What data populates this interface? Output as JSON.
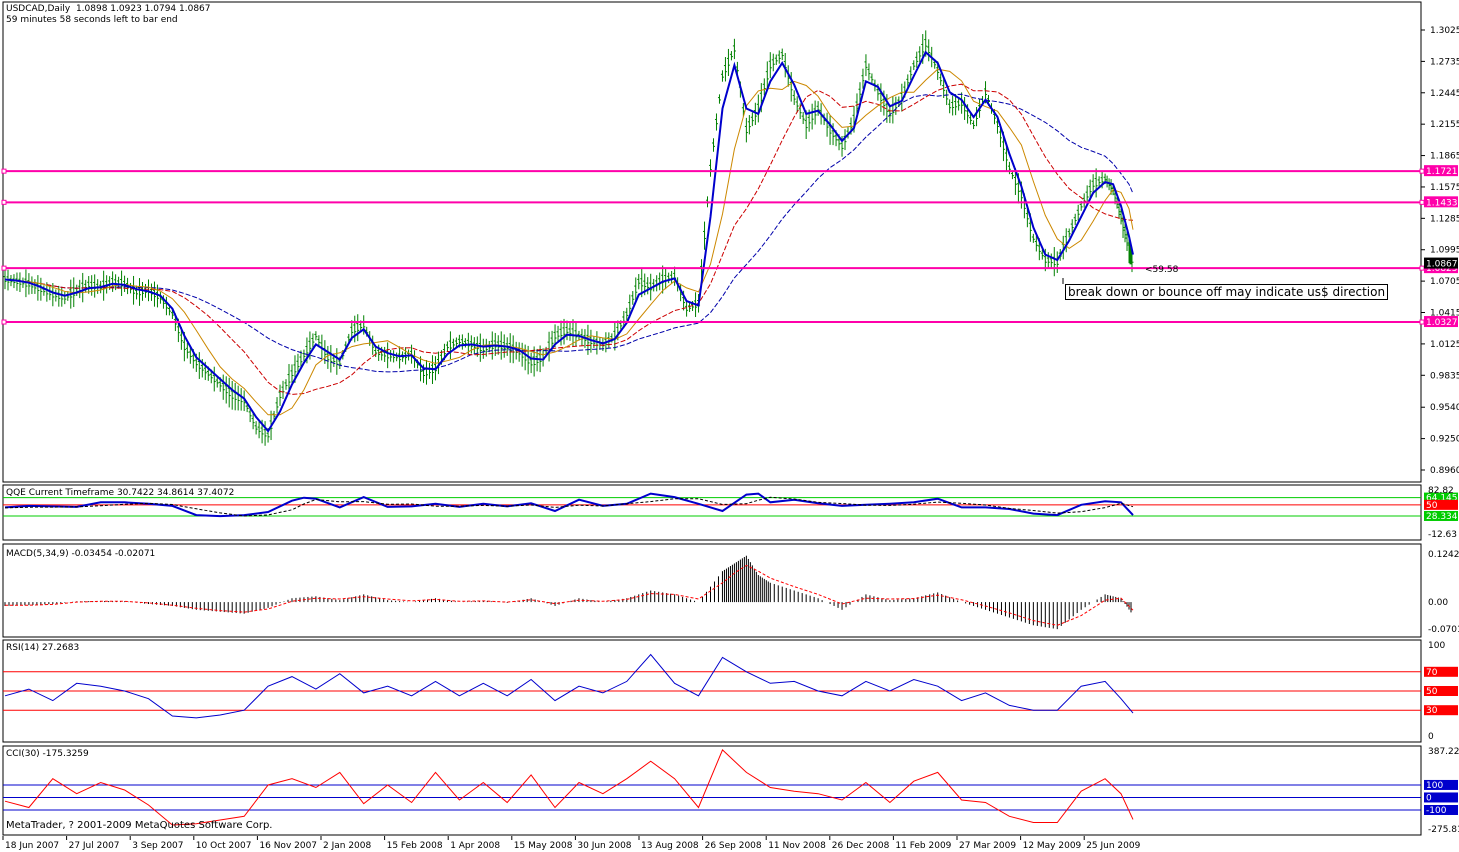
{
  "header": {
    "title": "USDCAD,Daily  1.0898 1.0923 1.0794 1.0867",
    "timer": "59 minutes 58 seconds left to bar end"
  },
  "annotations": {
    "main_note": "break down or bounce off may indicate us$ direction",
    "pips_label": "<59.58"
  },
  "footer": {
    "copyright": "MetaTrader, ? 2001-2009 MetaQuotes Software Corp."
  },
  "colors": {
    "price_bars": "#008000",
    "fast_ma": "#0000cc",
    "level_lines": "#ff00aa",
    "qqe_line": "#0000cc",
    "macd_hist": "#000000",
    "macd_signal": "#ff0000",
    "rsi_line": "#0000cc",
    "cci_line": "#ff0000",
    "green_level": "#00cc00",
    "red_level": "#ff0000"
  },
  "chart_data": [
    {
      "type": "line",
      "name": "price",
      "title": "USDCAD,Daily  1.0898 1.0923 1.0794 1.0867",
      "x_ticks": [
        "18 Jun 2007",
        "27 Jul 2007",
        "3 Sep 2007",
        "10 Oct 2007",
        "16 Nov 2007",
        "2 Jan 2008",
        "15 Feb 2008",
        "1 Apr 2008",
        "15 May 2008",
        "30 Jun 2008",
        "13 Aug 2008",
        "26 Sep 2008",
        "11 Nov 2008",
        "26 Dec 2008",
        "11 Feb 2009",
        "27 Mar 2009",
        "12 May 2009",
        "25 Jun 2009"
      ],
      "y_ticks": [
        "1.3025",
        "1.2735",
        "1.2445",
        "1.2155",
        "1.1865",
        "1.1575",
        "1.1285",
        "1.0995",
        "1.0705",
        "1.0415",
        "1.0125",
        "0.9835",
        "0.9540",
        "0.9250",
        "0.8960"
      ],
      "ylim": [
        0.896,
        1.31
      ],
      "current_price_label": "1.0867",
      "levels": [
        {
          "value": 1.1721,
          "label": "1.1721"
        },
        {
          "value": 1.1433,
          "label": "1.1433"
        },
        {
          "value": 1.0825,
          "label": "1.0825"
        },
        {
          "value": 1.0327,
          "label": "1.0327"
        }
      ],
      "x": [
        0,
        12,
        24,
        36,
        48,
        60,
        72,
        84,
        96,
        108,
        120,
        132,
        144,
        156,
        168,
        180,
        192,
        204,
        216,
        228,
        240,
        252,
        264,
        276,
        288,
        300,
        312,
        324,
        336,
        348,
        360,
        372,
        384,
        396,
        408,
        420,
        432,
        444,
        456,
        468,
        480,
        492,
        504,
        516,
        528,
        540,
        552,
        564,
        576,
        588,
        600,
        612,
        624,
        636,
        648,
        660,
        672,
        684,
        696,
        708,
        720,
        732,
        744,
        756,
        768,
        780,
        792,
        804,
        816,
        828,
        840,
        852,
        864,
        876,
        888,
        900,
        912,
        924,
        936,
        948,
        960,
        972,
        984,
        996,
        1008,
        1020,
        1032,
        1044,
        1056,
        1068,
        1080,
        1092,
        1104,
        1112,
        1120,
        1128,
        1132
      ],
      "close": [
        1.072,
        1.07,
        1.068,
        1.063,
        1.058,
        1.055,
        1.062,
        1.067,
        1.065,
        1.07,
        1.068,
        1.06,
        1.062,
        1.055,
        1.04,
        1.01,
        0.995,
        0.985,
        0.975,
        0.965,
        0.96,
        0.935,
        0.928,
        0.965,
        0.985,
        1.002,
        1.02,
        1.0,
        0.995,
        1.025,
        1.03,
        1.005,
        1.002,
        1.0,
        1.003,
        0.985,
        0.99,
        1.01,
        1.015,
        1.012,
        1.008,
        1.012,
        1.01,
        1.005,
        0.995,
        1.0,
        1.02,
        1.025,
        1.02,
        1.015,
        1.012,
        1.02,
        1.04,
        1.07,
        1.065,
        1.072,
        1.075,
        1.045,
        1.05,
        1.175,
        1.26,
        1.285,
        1.21,
        1.23,
        1.27,
        1.28,
        1.24,
        1.215,
        1.23,
        1.21,
        1.195,
        1.22,
        1.27,
        1.245,
        1.225,
        1.24,
        1.27,
        1.29,
        1.265,
        1.232,
        1.235,
        1.215,
        1.245,
        1.215,
        1.175,
        1.15,
        1.11,
        1.09,
        1.088,
        1.115,
        1.14,
        1.16,
        1.165,
        1.155,
        1.13,
        1.1,
        1.087
      ],
      "fast_ma": [
        1.072,
        1.071,
        1.069,
        1.065,
        1.06,
        1.057,
        1.06,
        1.064,
        1.065,
        1.068,
        1.067,
        1.063,
        1.061,
        1.057,
        1.045,
        1.02,
        1.0,
        0.99,
        0.98,
        0.97,
        0.962,
        0.945,
        0.932,
        0.95,
        0.975,
        0.995,
        1.012,
        1.005,
        0.998,
        1.018,
        1.026,
        1.01,
        1.004,
        1.001,
        1.002,
        0.99,
        0.989,
        1.003,
        1.011,
        1.012,
        1.01,
        1.011,
        1.01,
        1.007,
        0.999,
        0.998,
        1.012,
        1.021,
        1.02,
        1.016,
        1.013,
        1.017,
        1.032,
        1.058,
        1.064,
        1.07,
        1.073,
        1.052,
        1.048,
        1.13,
        1.23,
        1.27,
        1.23,
        1.225,
        1.255,
        1.272,
        1.252,
        1.225,
        1.228,
        1.215,
        1.2,
        1.212,
        1.255,
        1.25,
        1.232,
        1.237,
        1.26,
        1.282,
        1.272,
        1.245,
        1.238,
        1.222,
        1.238,
        1.222,
        1.188,
        1.158,
        1.12,
        1.095,
        1.09,
        1.108,
        1.13,
        1.152,
        1.162,
        1.16,
        1.14,
        1.112,
        1.095
      ]
    },
    {
      "type": "line",
      "name": "qqe",
      "title": "QQE Current Timeframe 30.7422 34.8614 37.4072",
      "y_ticks": [
        "82.82",
        "-12.63"
      ],
      "ylim": [
        -12.63,
        82.82
      ],
      "levels": [
        {
          "value": 64.1453,
          "label": "64.1453"
        },
        {
          "value": 50,
          "label": "50"
        },
        {
          "value": 28.3343,
          "label": "28.3343"
        }
      ],
      "x": [
        0,
        24,
        48,
        72,
        96,
        120,
        144,
        168,
        192,
        216,
        240,
        264,
        288,
        300,
        312,
        336,
        360,
        384,
        408,
        432,
        456,
        480,
        504,
        528,
        552,
        576,
        600,
        624,
        648,
        672,
        696,
        720,
        744,
        756,
        768,
        792,
        816,
        840,
        864,
        888,
        912,
        936,
        960,
        984,
        1008,
        1032,
        1056,
        1080,
        1104,
        1120,
        1132
      ],
      "values": [
        45,
        48,
        47,
        46,
        55,
        55,
        52,
        48,
        30,
        28,
        30,
        36,
        58,
        64,
        62,
        45,
        65,
        46,
        47,
        52,
        46,
        52,
        47,
        53,
        38,
        60,
        48,
        52,
        72,
        65,
        52,
        38,
        70,
        72,
        55,
        60,
        53,
        48,
        50,
        52,
        55,
        62,
        45,
        45,
        42,
        33,
        30,
        50,
        57,
        55,
        30
      ]
    },
    {
      "type": "bar",
      "name": "macd",
      "title": "MACD(5,34,9) -0.03454 -0.02071",
      "y_ticks": [
        "0.12426",
        "0.00",
        "-0.07018"
      ],
      "ylim": [
        -0.08,
        0.14
      ],
      "x": [
        0,
        24,
        48,
        72,
        96,
        120,
        144,
        168,
        192,
        216,
        240,
        264,
        288,
        312,
        336,
        360,
        384,
        408,
        432,
        456,
        480,
        504,
        528,
        552,
        576,
        600,
        624,
        648,
        672,
        696,
        720,
        732,
        744,
        756,
        768,
        792,
        816,
        840,
        864,
        888,
        912,
        936,
        960,
        984,
        1008,
        1032,
        1056,
        1080,
        1104,
        1120,
        1132
      ],
      "values": [
        -0.01,
        -0.008,
        -0.005,
        0.002,
        0.003,
        0.002,
        -0.005,
        -0.01,
        -0.02,
        -0.025,
        -0.03,
        -0.015,
        0.01,
        0.015,
        0.005,
        0.02,
        0.005,
        0.0,
        0.01,
        0.0,
        0.004,
        -0.002,
        0.01,
        -0.01,
        0.01,
        0.0,
        0.01,
        0.03,
        0.02,
        0.0,
        0.08,
        0.1,
        0.12,
        0.07,
        0.05,
        0.03,
        0.01,
        -0.02,
        0.02,
        0.005,
        0.01,
        0.025,
        0.0,
        -0.02,
        -0.04,
        -0.06,
        -0.07,
        -0.02,
        0.02,
        0.01,
        -0.034
      ],
      "signal": [
        -0.008,
        -0.008,
        -0.006,
        0.0,
        0.002,
        0.002,
        -0.002,
        -0.008,
        -0.016,
        -0.022,
        -0.026,
        -0.018,
        0.002,
        0.01,
        0.008,
        0.014,
        0.008,
        0.003,
        0.007,
        0.002,
        0.003,
        0.0,
        0.006,
        -0.004,
        0.005,
        0.002,
        0.007,
        0.022,
        0.02,
        0.008,
        0.05,
        0.075,
        0.095,
        0.08,
        0.062,
        0.04,
        0.02,
        -0.005,
        0.01,
        0.008,
        0.009,
        0.018,
        0.006,
        -0.01,
        -0.028,
        -0.048,
        -0.06,
        -0.035,
        0.005,
        0.01,
        -0.021
      ]
    },
    {
      "type": "line",
      "name": "rsi",
      "title": "RSI(14) 27.2683",
      "y_ticks": [
        "100",
        "0"
      ],
      "ylim": [
        0,
        100
      ],
      "levels": [
        {
          "value": 70,
          "label": "70"
        },
        {
          "value": 50,
          "label": "50"
        },
        {
          "value": 30,
          "label": "30"
        }
      ],
      "x": [
        0,
        24,
        48,
        72,
        96,
        120,
        144,
        168,
        192,
        216,
        240,
        264,
        288,
        312,
        336,
        360,
        384,
        408,
        432,
        456,
        480,
        504,
        528,
        552,
        576,
        600,
        624,
        648,
        672,
        696,
        720,
        744,
        768,
        792,
        816,
        840,
        864,
        888,
        912,
        936,
        960,
        984,
        1008,
        1032,
        1056,
        1080,
        1104,
        1120,
        1132
      ],
      "values": [
        45,
        52,
        40,
        58,
        55,
        50,
        42,
        24,
        22,
        25,
        30,
        55,
        65,
        52,
        68,
        48,
        55,
        45,
        60,
        45,
        58,
        45,
        62,
        40,
        55,
        48,
        60,
        88,
        58,
        45,
        85,
        70,
        58,
        60,
        50,
        45,
        60,
        50,
        62,
        55,
        40,
        48,
        35,
        30,
        30,
        55,
        60,
        42,
        27
      ]
    },
    {
      "type": "line",
      "name": "cci",
      "title": "CCI(30) -175.3259",
      "y_ticks": [
        "387.2261",
        "-275.8157"
      ],
      "ylim": [
        -275.8157,
        387.2261
      ],
      "levels": [
        {
          "value": 100,
          "label": "100"
        },
        {
          "value": 0,
          "label": "0"
        },
        {
          "value": -100,
          "label": "-100"
        }
      ],
      "x": [
        0,
        24,
        48,
        72,
        96,
        120,
        144,
        168,
        192,
        216,
        240,
        264,
        288,
        312,
        336,
        360,
        384,
        408,
        432,
        456,
        480,
        504,
        528,
        552,
        576,
        600,
        624,
        648,
        672,
        696,
        720,
        744,
        768,
        792,
        816,
        840,
        864,
        888,
        912,
        936,
        960,
        984,
        1008,
        1032,
        1056,
        1080,
        1104,
        1120,
        1132
      ],
      "values": [
        -30,
        -80,
        150,
        30,
        120,
        60,
        -60,
        -220,
        -210,
        -180,
        -150,
        100,
        150,
        80,
        200,
        -50,
        100,
        -40,
        200,
        -20,
        120,
        -40,
        180,
        -80,
        120,
        30,
        150,
        290,
        150,
        -80,
        380,
        200,
        80,
        50,
        30,
        -20,
        120,
        -40,
        130,
        200,
        -20,
        -40,
        -150,
        -200,
        -200,
        50,
        150,
        30,
        -175
      ]
    }
  ]
}
